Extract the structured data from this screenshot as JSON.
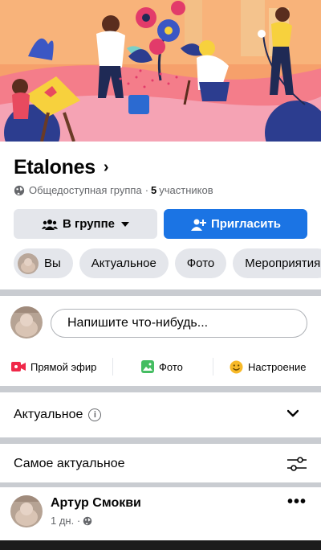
{
  "group": {
    "name": "Etalones",
    "privacy": "Общедоступная группа",
    "separator": "·",
    "member_count": "5",
    "member_label": "участников"
  },
  "buttons": {
    "in_group": "В группе",
    "invite": "Пригласить"
  },
  "chips": [
    "Вы",
    "Актуальное",
    "Фото",
    "Мероприятия"
  ],
  "composer": {
    "placeholder": "Напишите что-нибудь...",
    "actions": {
      "live": "Прямой эфир",
      "photo": "Фото",
      "feeling": "Настроение"
    }
  },
  "sections": {
    "featured": "Актуальное",
    "sort": "Самое актуальное"
  },
  "post": {
    "author": "Артур Смокви",
    "time": "1 дн. ·"
  },
  "icons": {
    "globe": "globe-icon",
    "members": "members-icon",
    "add_person": "add-person-icon",
    "live": "live-video-icon",
    "photo": "photo-icon",
    "feeling": "feeling-icon",
    "info": "info-icon",
    "chevron_down": "chevron-down-icon",
    "sort": "sort-sliders-icon",
    "more": "more-dots-icon"
  },
  "colors": {
    "accent": "#1b74e4",
    "button_gray": "#e4e6eb",
    "separator": "#c9ccd1",
    "live_red": "#f02849",
    "photo_green": "#45bd62",
    "feeling_yellow": "#f7b928"
  }
}
